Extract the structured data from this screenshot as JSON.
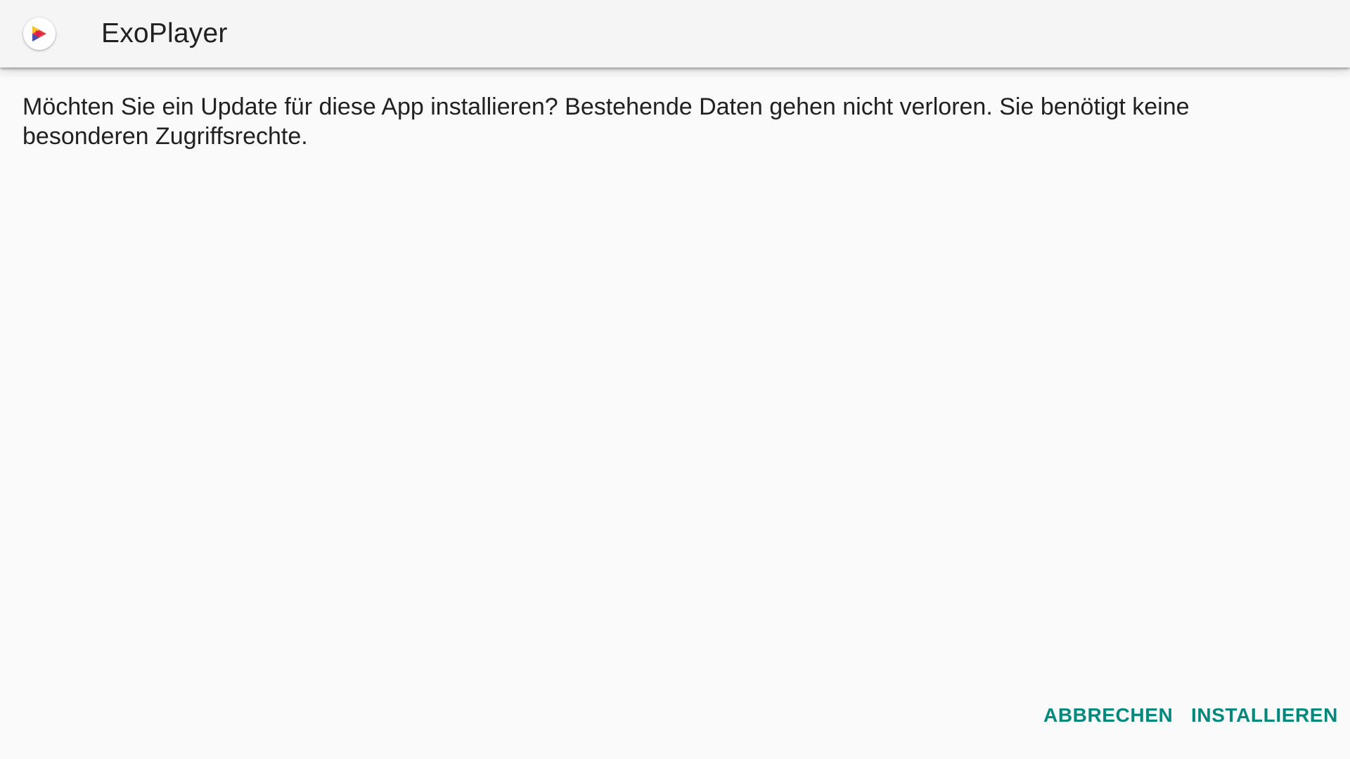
{
  "header": {
    "app_title": "ExoPlayer",
    "app_icon": "exoplayer-app-icon"
  },
  "message": "Möchten Sie ein Update für diese App installieren? Bestehende Daten gehen nicht verloren. Sie benötigt keine besonderen Zugriffsrechte.",
  "actions": {
    "cancel_label": "ABBRECHEN",
    "install_label": "INSTALLIEREN"
  },
  "colors": {
    "accent": "#00897b",
    "toolbar_bg": "#f5f5f5",
    "page_bg": "#fafafa",
    "text": "#212121"
  }
}
